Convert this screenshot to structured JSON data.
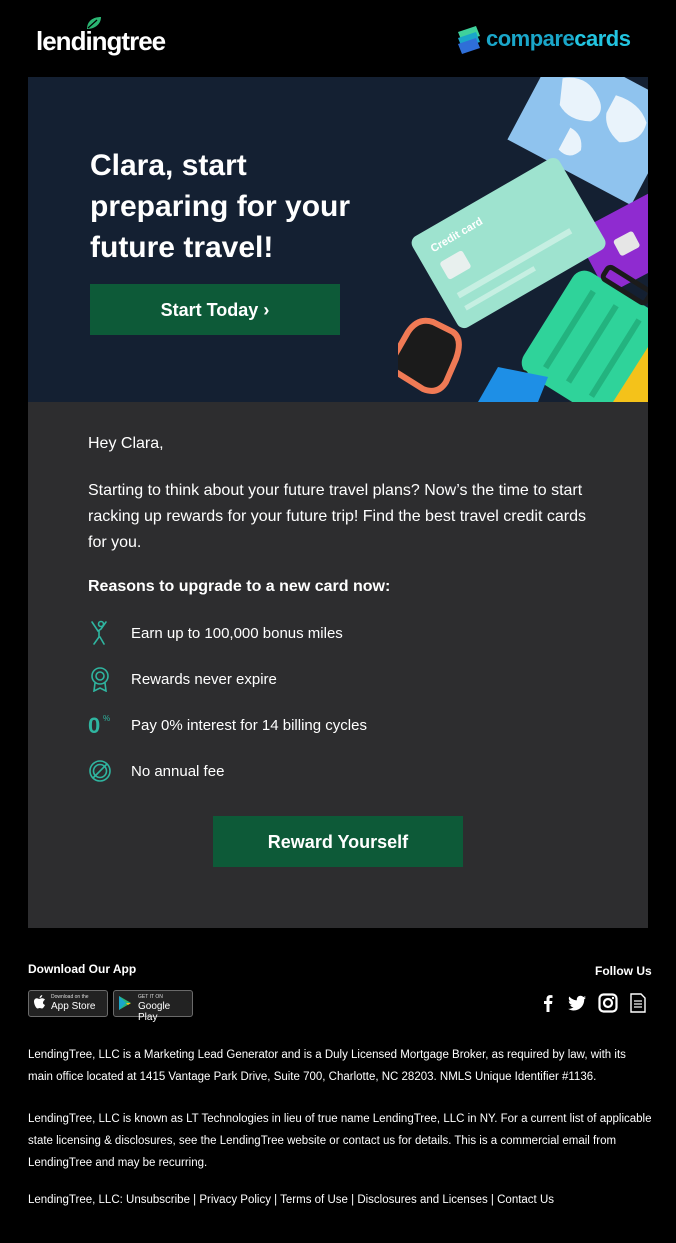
{
  "header": {
    "lendingtree_logo": "lendingtree",
    "comparecards_logo_a": "compare",
    "comparecards_logo_b": "cards"
  },
  "hero": {
    "title": "Clara, start preparing for your future travel!",
    "cta_label": "Start Today",
    "cta_icon": "chevron-right",
    "card_text": "Credit card"
  },
  "body": {
    "greeting": "Hey Clara,",
    "intro": "Starting to think about your future travel plans? Now’s the time to start racking up rewards for your future trip! Find the best travel credit cards for you.",
    "reasons_heading": "Reasons to upgrade to a new card now:",
    "reasons": [
      {
        "icon": "person-celebrate-icon",
        "text": "Earn up to 100,000 bonus miles"
      },
      {
        "icon": "award-ribbon-icon",
        "text": "Rewards never expire"
      },
      {
        "icon": "zero-percent-icon",
        "text": "Pay 0% interest for 14 billing cycles"
      },
      {
        "icon": "no-fee-icon",
        "text": "No annual fee"
      }
    ],
    "cta_label": "Reward Yourself"
  },
  "footer": {
    "download_label": "Download Our App",
    "app_store_small": "Download on the",
    "app_store_big": "App Store",
    "google_play_small": "GET IT ON",
    "google_play_big": "Google Play",
    "follow_label": "Follow Us",
    "social_icons": [
      "facebook-icon",
      "twitter-icon",
      "instagram-icon",
      "blog-icon"
    ],
    "legal_1": "LendingTree, LLC is a Marketing Lead Generator and is a Duly Licensed Mortgage Broker, as required by law, with its main office located at 1415 Vantage Park Drive, Suite 700, Charlotte, NC 28203. NMLS Unique Identifier #1136.",
    "legal_2": "LendingTree, LLC is known as LT Technologies in lieu of true name LendingTree, LLC in NY. For a current list of applicable state licensing & disclosures, see the LendingTree website or contact us for details. This is a commercial email from LendingTree and may be recurring.",
    "links_prefix": "LendingTree, LLC:",
    "links": [
      "Unsubscribe",
      "Privacy Policy",
      "Terms of Use",
      "Disclosures and Licenses",
      "Contact Us"
    ],
    "separator": "|"
  },
  "colors": {
    "page_bg": "#000000",
    "hero_bg": "#142032",
    "panel_bg": "#2d2d2f",
    "button_green": "#0d5a38",
    "icon_teal": "#2fb5a0",
    "brand_blue": "#1aa6c9"
  }
}
